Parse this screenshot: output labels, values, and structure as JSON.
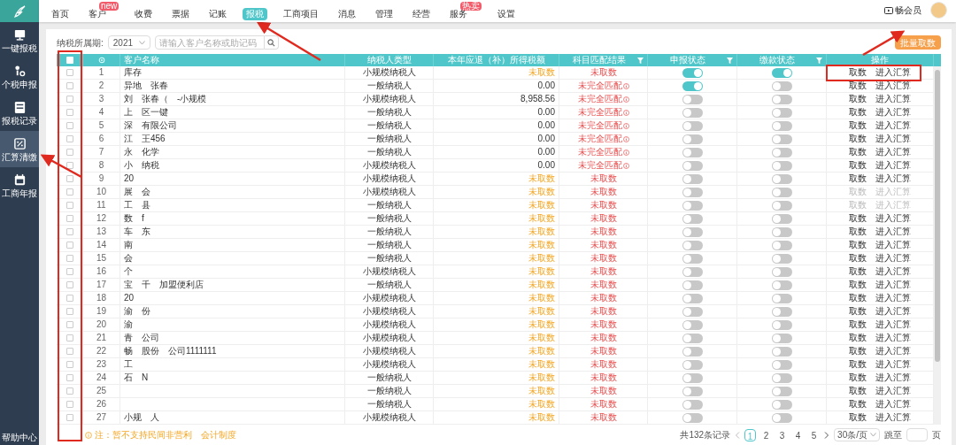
{
  "sidebar": {
    "items": [
      {
        "label": "一键报税",
        "selected": false
      },
      {
        "label": "个税申报",
        "selected": false
      },
      {
        "label": "报税记录",
        "selected": false
      },
      {
        "label": "汇算清缴",
        "selected": true
      },
      {
        "label": "工商年报",
        "selected": false
      }
    ],
    "footer": "帮助中心"
  },
  "nav": {
    "items": [
      {
        "label": "首页",
        "selected": false
      },
      {
        "label": "客户",
        "selected": false,
        "badge": "new"
      },
      {
        "label": "收费",
        "selected": false
      },
      {
        "label": "票据",
        "selected": false
      },
      {
        "label": "记账",
        "selected": false
      },
      {
        "label": "报税",
        "selected": true
      },
      {
        "label": "工商项目",
        "selected": false
      },
      {
        "label": "消息",
        "selected": false
      },
      {
        "label": "管理",
        "selected": false
      },
      {
        "label": "经营",
        "selected": false
      },
      {
        "label": "服务",
        "selected": false,
        "badge": "热卖"
      },
      {
        "label": "设置",
        "selected": false
      }
    ],
    "member": "畅会员"
  },
  "filter": {
    "label": "纳税所属期:",
    "period": "2021",
    "search_placeholder": "请输入客户名称或助记码"
  },
  "batch_button": "批量取数",
  "table": {
    "all_checked": false,
    "columns": [
      {
        "kind": "checkbox"
      },
      {
        "kind": "settings"
      },
      {
        "kind": "text",
        "label": "客户名称"
      },
      {
        "kind": "text",
        "label": "纳税人类型"
      },
      {
        "kind": "text",
        "label": "本年应退（补）所得税额"
      },
      {
        "kind": "text",
        "label": "科目匹配结果",
        "filter": true
      },
      {
        "kind": "text",
        "label": "申报状态",
        "filter": true
      },
      {
        "kind": "text",
        "label": "缴款状态",
        "filter": true
      },
      {
        "kind": "text",
        "label": "操作"
      }
    ],
    "rows": [
      {
        "no": "1",
        "name": "库存",
        "checked": false,
        "type": "小规模纳税人",
        "amount": "未取数",
        "pending": true,
        "match": "未取数",
        "info": false,
        "declared": true,
        "paid": true,
        "actions": [
          "取数",
          "进入汇算"
        ],
        "disabled": false
      },
      {
        "no": "2",
        "name": "异地　张春",
        "checked": false,
        "type": "一般纳税人",
        "amount": "0.00",
        "pending": false,
        "match": "未完全匹配",
        "info": true,
        "declared": true,
        "paid": false,
        "actions": [
          "取数",
          "进入汇算"
        ],
        "disabled": false
      },
      {
        "no": "3",
        "name": "刘　张春（　-小规模",
        "checked": false,
        "type": "小规模纳税人",
        "amount": "8,958.56",
        "pending": false,
        "match": "未完全匹配",
        "info": true,
        "declared": false,
        "paid": false,
        "actions": [
          "取数",
          "进入汇算"
        ],
        "disabled": false
      },
      {
        "no": "4",
        "name": "上　区一键",
        "checked": false,
        "type": "一般纳税人",
        "amount": "0.00",
        "pending": false,
        "match": "未完全匹配",
        "info": true,
        "declared": false,
        "paid": false,
        "actions": [
          "取数",
          "进入汇算"
        ],
        "disabled": false
      },
      {
        "no": "5",
        "name": "深　有限公司",
        "checked": false,
        "type": "一般纳税人",
        "amount": "0.00",
        "pending": false,
        "match": "未完全匹配",
        "info": true,
        "declared": false,
        "paid": false,
        "actions": [
          "取数",
          "进入汇算"
        ],
        "disabled": false
      },
      {
        "no": "6",
        "name": "江　王456",
        "checked": false,
        "type": "一般纳税人",
        "amount": "0.00",
        "pending": false,
        "match": "未完全匹配",
        "info": true,
        "declared": false,
        "paid": false,
        "actions": [
          "取数",
          "进入汇算"
        ],
        "disabled": false
      },
      {
        "no": "7",
        "name": "永　化学",
        "checked": false,
        "type": "一般纳税人",
        "amount": "0.00",
        "pending": false,
        "match": "未完全匹配",
        "info": true,
        "declared": false,
        "paid": false,
        "actions": [
          "取数",
          "进入汇算"
        ],
        "disabled": false
      },
      {
        "no": "8",
        "name": "小　纳税",
        "checked": false,
        "type": "小规模纳税人",
        "amount": "0.00",
        "pending": false,
        "match": "未完全匹配",
        "info": true,
        "declared": false,
        "paid": false,
        "actions": [
          "取数",
          "进入汇算"
        ],
        "disabled": false
      },
      {
        "no": "9",
        "name": "20",
        "checked": false,
        "type": "小规模纳税人",
        "amount": "未取数",
        "pending": true,
        "match": "未取数",
        "info": false,
        "declared": false,
        "paid": false,
        "actions": [
          "取数",
          "进入汇算"
        ],
        "disabled": false
      },
      {
        "no": "10",
        "name": "展　会",
        "checked": false,
        "type": "小规模纳税人",
        "amount": "未取数",
        "pending": true,
        "match": "未取数",
        "info": false,
        "declared": false,
        "paid": false,
        "actions": [
          "取数",
          "进入汇算"
        ],
        "disabled": true
      },
      {
        "no": "11",
        "name": "工　县",
        "checked": false,
        "type": "一般纳税人",
        "amount": "未取数",
        "pending": true,
        "match": "未取数",
        "info": false,
        "declared": false,
        "paid": false,
        "actions": [
          "取数",
          "进入汇算"
        ],
        "disabled": true
      },
      {
        "no": "12",
        "name": "数　f",
        "checked": false,
        "type": "一般纳税人",
        "amount": "未取数",
        "pending": true,
        "match": "未取数",
        "info": false,
        "declared": false,
        "paid": false,
        "actions": [
          "取数",
          "进入汇算"
        ],
        "disabled": false
      },
      {
        "no": "13",
        "name": "车　东",
        "checked": false,
        "type": "一般纳税人",
        "amount": "未取数",
        "pending": true,
        "match": "未取数",
        "info": false,
        "declared": false,
        "paid": false,
        "actions": [
          "取数",
          "进入汇算"
        ],
        "disabled": false
      },
      {
        "no": "14",
        "name": "南",
        "checked": false,
        "type": "一般纳税人",
        "amount": "未取数",
        "pending": true,
        "match": "未取数",
        "info": false,
        "declared": false,
        "paid": false,
        "actions": [
          "取数",
          "进入汇算"
        ],
        "disabled": false
      },
      {
        "no": "15",
        "name": "会",
        "checked": false,
        "type": "一般纳税人",
        "amount": "未取数",
        "pending": true,
        "match": "未取数",
        "info": false,
        "declared": false,
        "paid": false,
        "actions": [
          "取数",
          "进入汇算"
        ],
        "disabled": false
      },
      {
        "no": "16",
        "name": "个",
        "checked": false,
        "type": "小规模纳税人",
        "amount": "未取数",
        "pending": true,
        "match": "未取数",
        "info": false,
        "declared": false,
        "paid": false,
        "actions": [
          "取数",
          "进入汇算"
        ],
        "disabled": false
      },
      {
        "no": "17",
        "name": "宝　千　加盟便利店",
        "checked": false,
        "type": "一般纳税人",
        "amount": "未取数",
        "pending": true,
        "match": "未取数",
        "info": false,
        "declared": false,
        "paid": false,
        "actions": [
          "取数",
          "进入汇算"
        ],
        "disabled": false
      },
      {
        "no": "18",
        "name": "20",
        "checked": false,
        "type": "小规模纳税人",
        "amount": "未取数",
        "pending": true,
        "match": "未取数",
        "info": false,
        "declared": false,
        "paid": false,
        "actions": [
          "取数",
          "进入汇算"
        ],
        "disabled": false
      },
      {
        "no": "19",
        "name": "渝　份",
        "checked": false,
        "type": "小规模纳税人",
        "amount": "未取数",
        "pending": true,
        "match": "未取数",
        "info": false,
        "declared": false,
        "paid": false,
        "actions": [
          "取数",
          "进入汇算"
        ],
        "disabled": false
      },
      {
        "no": "20",
        "name": "渝",
        "checked": false,
        "type": "小规模纳税人",
        "amount": "未取数",
        "pending": true,
        "match": "未取数",
        "info": false,
        "declared": false,
        "paid": false,
        "actions": [
          "取数",
          "进入汇算"
        ],
        "disabled": false
      },
      {
        "no": "21",
        "name": "青　公司",
        "checked": false,
        "type": "小规模纳税人",
        "amount": "未取数",
        "pending": true,
        "match": "未取数",
        "info": false,
        "declared": false,
        "paid": false,
        "actions": [
          "取数",
          "进入汇算"
        ],
        "disabled": false
      },
      {
        "no": "22",
        "name": "畅　股份　公司1111111",
        "checked": false,
        "type": "小规模纳税人",
        "amount": "未取数",
        "pending": true,
        "match": "未取数",
        "info": false,
        "declared": false,
        "paid": false,
        "actions": [
          "取数",
          "进入汇算"
        ],
        "disabled": false
      },
      {
        "no": "23",
        "name": "工",
        "checked": false,
        "type": "小规模纳税人",
        "amount": "未取数",
        "pending": true,
        "match": "未取数",
        "info": false,
        "declared": false,
        "paid": false,
        "actions": [
          "取数",
          "进入汇算"
        ],
        "disabled": false
      },
      {
        "no": "24",
        "name": "石　N",
        "checked": false,
        "type": "一般纳税人",
        "amount": "未取数",
        "pending": true,
        "match": "未取数",
        "info": false,
        "declared": false,
        "paid": false,
        "actions": [
          "取数",
          "进入汇算"
        ],
        "disabled": false
      },
      {
        "no": "25",
        "checked": false,
        "type": "一般纳税人",
        "amount": "未取数",
        "pending": true,
        "match": "未取数",
        "info": false,
        "declared": false,
        "paid": false,
        "actions": [
          "取数",
          "进入汇算"
        ],
        "disabled": false
      },
      {
        "no": "26",
        "checked": false,
        "type": "一般纳税人",
        "amount": "未取数",
        "pending": true,
        "match": "未取数",
        "info": false,
        "declared": false,
        "paid": false,
        "actions": [
          "取数",
          "进入汇算"
        ],
        "disabled": false
      },
      {
        "no": "27",
        "name": "小规　人",
        "checked": false,
        "type": "小规模纳税人",
        "amount": "未取数",
        "pending": true,
        "match": "未取数",
        "info": false,
        "declared": false,
        "paid": false,
        "actions": [
          "取数",
          "进入汇算"
        ],
        "disabled": false
      }
    ]
  },
  "note": "注：暂不支持民间非营利　会计制度",
  "pagination": {
    "total": "共132条记录",
    "pages": [
      {
        "label": "1",
        "selected": true
      },
      {
        "label": "2",
        "selected": false
      },
      {
        "label": "3",
        "selected": false
      },
      {
        "label": "4",
        "selected": false
      },
      {
        "label": "5",
        "selected": false
      }
    ],
    "page_size": "30条/页",
    "jump_label": "跳至",
    "page_unit": "页"
  }
}
